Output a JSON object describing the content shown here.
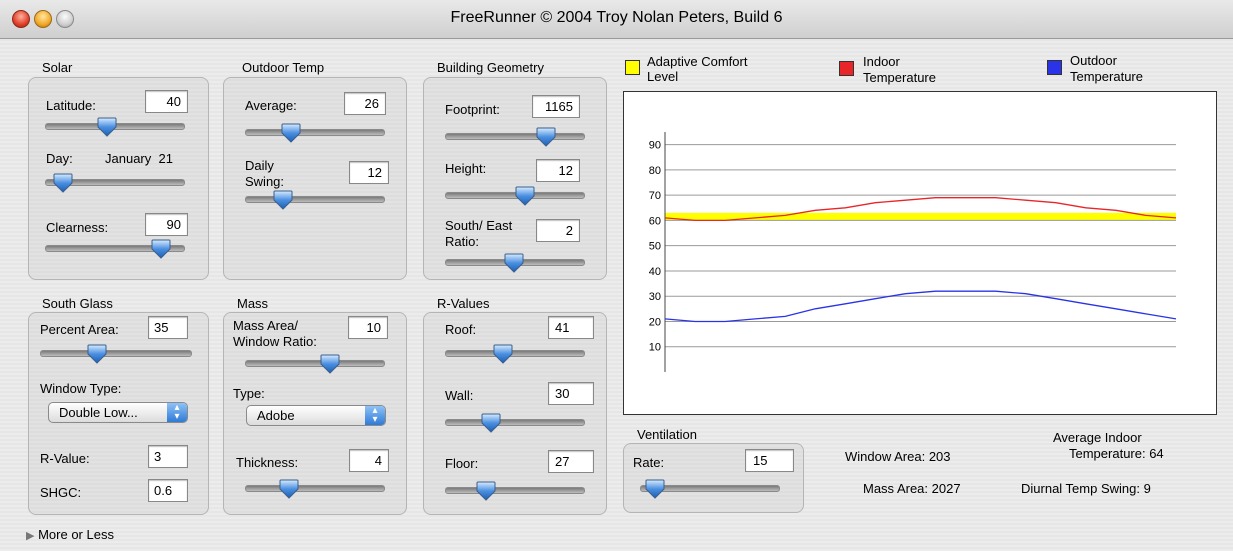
{
  "window": {
    "title": "FreeRunner © 2004 Troy Nolan Peters, Build 6"
  },
  "solar": {
    "title": "Solar",
    "latitude_label": "Latitude:",
    "latitude_value": "40",
    "day_label": "Day:",
    "day_value": "January  21",
    "clearness_label": "Clearness:",
    "clearness_value": "90"
  },
  "outdoor_temp": {
    "title": "Outdoor Temp",
    "average_label": "Average:",
    "average_value": "26",
    "swing_label_1": "Daily",
    "swing_label_2": "Swing:",
    "swing_value": "12"
  },
  "building_geometry": {
    "title": "Building Geometry",
    "footprint_label": "Footprint:",
    "footprint_value": "1165",
    "height_label": "Height:",
    "height_value": "12",
    "ratio_label_1": "South/ East",
    "ratio_label_2": "Ratio:",
    "ratio_value": "2"
  },
  "south_glass": {
    "title": "South Glass",
    "percent_label": "Percent Area:",
    "percent_value": "35",
    "window_type_label": "Window Type:",
    "window_type_value": "Double Low...",
    "rvalue_label": "R-Value:",
    "rvalue_value": "3",
    "shgc_label": "SHGC:",
    "shgc_value": "0.6"
  },
  "mass": {
    "title": "Mass",
    "ratio_label_1": "Mass Area/",
    "ratio_label_2": "Window Ratio:",
    "ratio_value": "10",
    "type_label": "Type:",
    "type_value": "Adobe",
    "thickness_label": "Thickness:",
    "thickness_value": "4"
  },
  "rvalues": {
    "title": "R-Values",
    "roof_label": "Roof:",
    "roof_value": "41",
    "wall_label": "Wall:",
    "wall_value": "30",
    "floor_label": "Floor:",
    "floor_value": "27"
  },
  "ventilation": {
    "title": "Ventilation",
    "rate_label": "Rate:",
    "rate_value": "15"
  },
  "legend": {
    "comfort_1": "Adaptive Comfort",
    "comfort_2": "Level",
    "indoor_1": "Indoor",
    "indoor_2": "Temperature",
    "outdoor_1": "Outdoor",
    "outdoor_2": "Temperature"
  },
  "stats": {
    "window_area": "Window Area: 203",
    "mass_area": "Mass Area: 2027",
    "avg_indoor_1": "Average Indoor",
    "avg_indoor_2": "Temperature: 64",
    "diurnal": "Diurnal Temp Swing: 9"
  },
  "more_or_less": "More or Less",
  "colors": {
    "comfort": "#ffff00",
    "indoor": "#e8262a",
    "outdoor": "#2a33e8",
    "slider_thumb": "#4a8fe0"
  },
  "chart_data": {
    "type": "line",
    "y_ticks": [
      10,
      20,
      30,
      40,
      50,
      60,
      70,
      80,
      90
    ],
    "ylim": [
      0,
      95
    ],
    "comfort_band": [
      60,
      63
    ],
    "series": [
      {
        "name": "Indoor Temperature",
        "values": [
          61,
          60,
          60,
          61,
          62,
          64,
          65,
          67,
          68,
          69,
          69,
          69,
          68,
          67,
          65,
          64,
          62,
          61
        ]
      },
      {
        "name": "Outdoor Temperature",
        "values": [
          21,
          20,
          20,
          21,
          22,
          25,
          27,
          29,
          31,
          32,
          32,
          32,
          31,
          29,
          27,
          25,
          23,
          21
        ]
      }
    ]
  }
}
